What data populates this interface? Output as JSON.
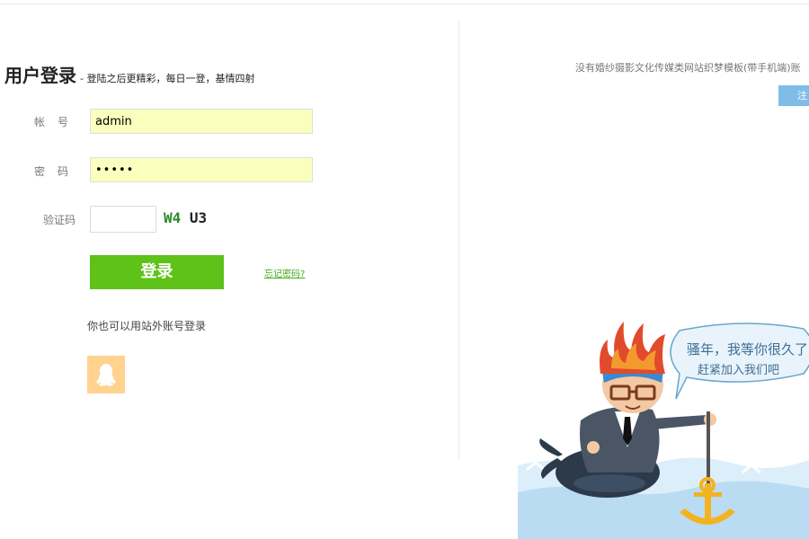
{
  "header": {
    "title": "用户登录",
    "subtitle": "- 登陆之后更精彩，每日一登，基情四射"
  },
  "form": {
    "account_label": "帐号",
    "account_value": "admin",
    "password_label": "密码",
    "password_value": "•••••",
    "captcha_label": "验证码",
    "captcha_value": "",
    "captcha_text_a": "W4",
    "captcha_text_b": "U3",
    "login_label": "登录",
    "forgot_label": "忘记密码?"
  },
  "alt_login": {
    "text": "你也可以用站外账号登录",
    "provider_icon": "qq-penguin-icon"
  },
  "right": {
    "notice": "没有婚纱摄影文化传媒类网站织梦模板(带手机端)账",
    "register_label": "注",
    "bubble_line1": "骚年，我等你很久了",
    "bubble_line2": "赶紧加入我们吧"
  },
  "colors": {
    "accent_green": "#5ec219",
    "register_blue": "#7fbde8",
    "autofill_yellow": "#faffbd",
    "qq_bg": "#ffd28f"
  }
}
